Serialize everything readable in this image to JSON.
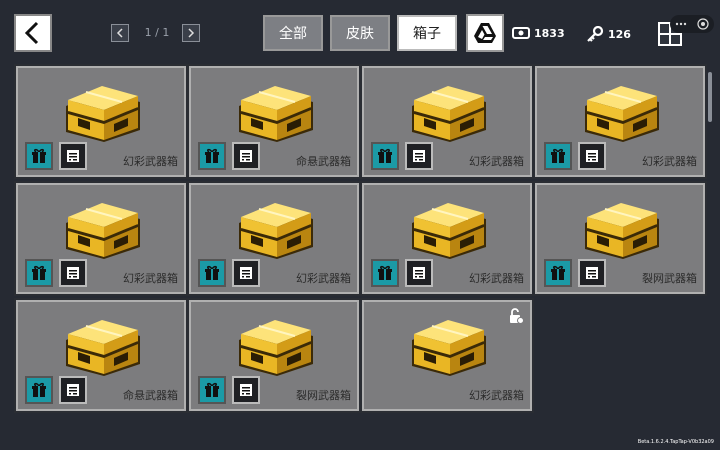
{
  "header": {
    "page_indicator": "1 / 1",
    "tabs": [
      {
        "label": "全部",
        "active": false
      },
      {
        "label": "皮肤",
        "active": false
      },
      {
        "label": "箱子",
        "active": true
      }
    ],
    "coins": "1833",
    "keys": "126"
  },
  "cards": [
    {
      "name": "幻彩武器箱",
      "buttons": true,
      "locked": false
    },
    {
      "name": "命悬武器箱",
      "buttons": true,
      "locked": false
    },
    {
      "name": "幻彩武器箱",
      "buttons": true,
      "locked": false
    },
    {
      "name": "幻彩武器箱",
      "buttons": true,
      "locked": false
    },
    {
      "name": "幻彩武器箱",
      "buttons": true,
      "locked": false
    },
    {
      "name": "幻彩武器箱",
      "buttons": true,
      "locked": false
    },
    {
      "name": "幻彩武器箱",
      "buttons": true,
      "locked": false
    },
    {
      "name": "裂网武器箱",
      "buttons": true,
      "locked": false
    },
    {
      "name": "命悬武器箱",
      "buttons": true,
      "locked": false
    },
    {
      "name": "裂网武器箱",
      "buttons": true,
      "locked": false
    },
    {
      "name": "幻彩武器箱",
      "buttons": false,
      "locked": true
    }
  ],
  "version": "Beta.1.6.2.4.TapTap-V0b32a09",
  "colors": {
    "background": "#262a33",
    "card": "#7c7c7e",
    "gift": "#1b9aa6",
    "gold": "#e8b823"
  }
}
